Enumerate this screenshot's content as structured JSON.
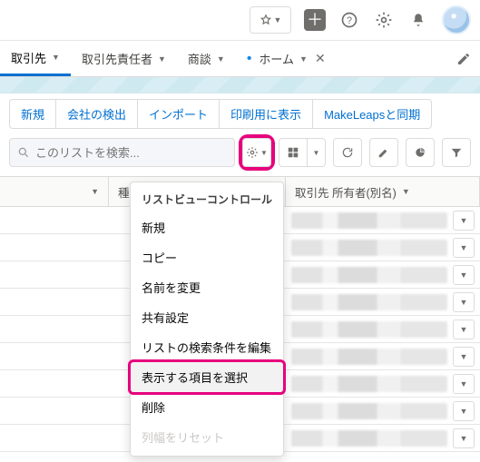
{
  "tabs": {
    "t1": "取引先",
    "t2": "取引先責任者",
    "t3": "商談",
    "t4": "ホーム"
  },
  "actions": {
    "a1": "新規",
    "a2": "会社の検出",
    "a3": "インポート",
    "a4": "印刷用に表示",
    "a5": "MakeLeapsと同期"
  },
  "search": {
    "placeholder": "このリストを検索..."
  },
  "columns": {
    "c2": "種",
    "c3": "取引先 所有者(別名)"
  },
  "menu": {
    "header": "リストビューコントロール",
    "m1": "新規",
    "m2": "コピー",
    "m3": "名前を変更",
    "m4": "共有設定",
    "m5": "リストの検索条件を編集",
    "m6": "表示する項目を選択",
    "m7": "削除",
    "m8": "列幅をリセット"
  }
}
